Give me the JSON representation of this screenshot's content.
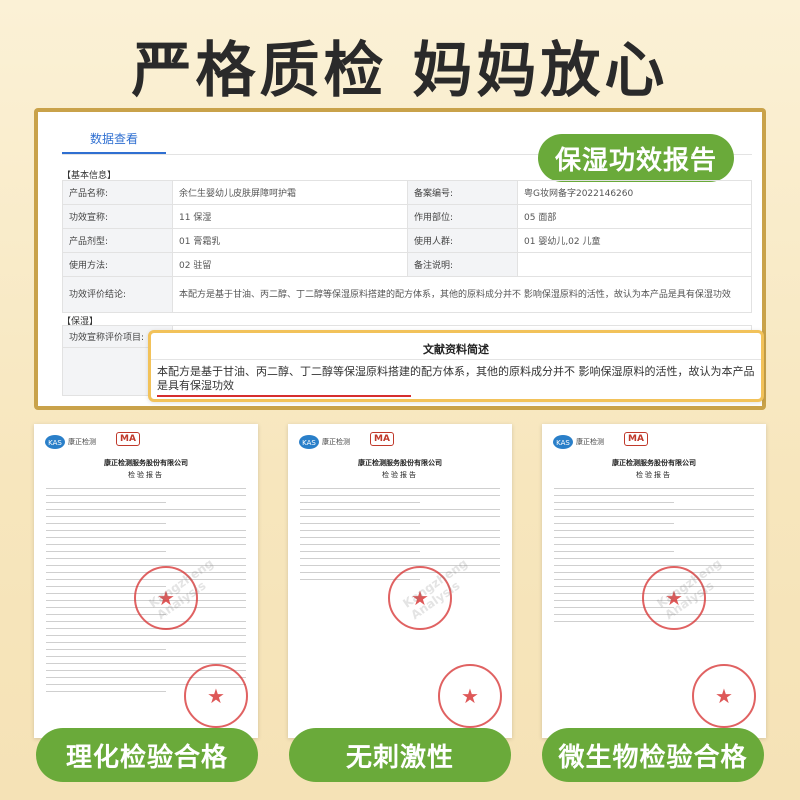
{
  "headline": "严格质检 妈妈放心",
  "panel": {
    "tab": "数据查看",
    "report_badge": "保湿功效报告",
    "basic_section": "【基本信息】",
    "rows": [
      {
        "k1": "产品名称:",
        "v1": "余仁生婴幼儿皮肤屏障呵护霜",
        "k2": "备案编号:",
        "v2": "粤G妆网备字2022146260"
      },
      {
        "k1": "功效宣称:",
        "v1": "11 保湿",
        "k2": "作用部位:",
        "v2": "05 面部"
      },
      {
        "k1": "产品剂型:",
        "v1": "01 膏霜乳",
        "k2": "使用人群:",
        "v2": "01 婴幼儿,02 儿童"
      },
      {
        "k1": "使用方法:",
        "v1": "02 驻留",
        "k2": "备注说明:",
        "v2": ""
      }
    ],
    "conclusion_label": "功效评价结论:",
    "conclusion_text": "本配方是基于甘油、丙二醇、丁二醇等保湿原料搭建的配方体系，其他的原料成分并不 影响保湿原料的活性，故认为本产品是具有保湿功效",
    "moist_section": "【保湿】",
    "moist_label": "功效宣称评价项目:",
    "popup_title": "文献资料简述",
    "popup_text": "本配方是基于甘油、丙二醇、丁二醇等保湿原料搭建的配方体系，其他的原料成分并不 影响保湿原料的活性，故认为本产品是具有保湿功效"
  },
  "docs": [
    {
      "brand": "康正检测",
      "ma": "MA",
      "company": "康正检测服务股份有限公司",
      "title": "检验报告",
      "watermark": "Kangzheng Analysis",
      "pill": "理化检验合格"
    },
    {
      "brand": "康正检测",
      "ma": "MA",
      "company": "康正检测服务股份有限公司",
      "title": "检验报告",
      "watermark": "Kangzheng Analysis",
      "pill": "无刺激性"
    },
    {
      "brand": "康正检测",
      "ma": "MA",
      "company": "康正检测服务股份有限公司",
      "title": "检验报告",
      "watermark": "Kangzheng Analysis",
      "pill": "微生物检验合格"
    }
  ],
  "colors": {
    "accent_green": "#6aaa3a",
    "frame_gold": "#c9a24a",
    "stamp_red": "#d62e2e",
    "tab_blue": "#2f6fd1"
  }
}
